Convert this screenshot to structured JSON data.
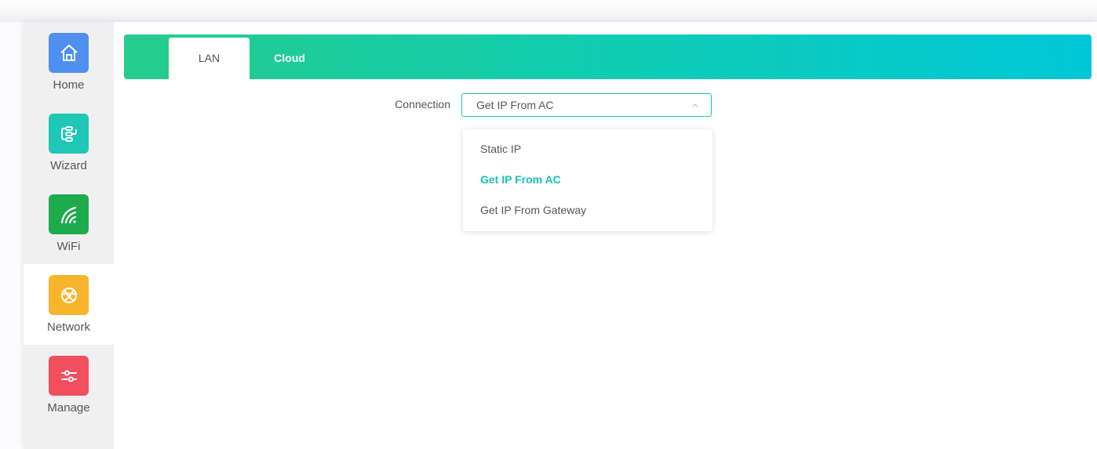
{
  "sidebar": {
    "items": [
      {
        "label": "Home",
        "icon": "home-icon",
        "color": "#4f8ff0",
        "active": false
      },
      {
        "label": "Wizard",
        "icon": "wizard-icon",
        "color": "#1fc7b6",
        "active": false
      },
      {
        "label": "WiFi",
        "icon": "wifi-icon",
        "color": "#1dab4d",
        "active": false
      },
      {
        "label": "Network",
        "icon": "globe-icon",
        "color": "#f7b52c",
        "active": true
      },
      {
        "label": "Manage",
        "icon": "sliders-icon",
        "color": "#f2505f",
        "active": false
      }
    ]
  },
  "header": {
    "tabs": [
      {
        "label": "LAN",
        "active": true
      },
      {
        "label": "Cloud",
        "active": false
      }
    ],
    "gradient": [
      "#25cc8c",
      "#00c7d8"
    ]
  },
  "form": {
    "connection_label": "Connection",
    "connection_value": "Get IP From AC",
    "accent_color": "#17c3b2",
    "options": [
      {
        "label": "Static IP",
        "selected": false
      },
      {
        "label": "Get IP From AC",
        "selected": true
      },
      {
        "label": "Get IP From Gateway",
        "selected": false
      }
    ]
  }
}
